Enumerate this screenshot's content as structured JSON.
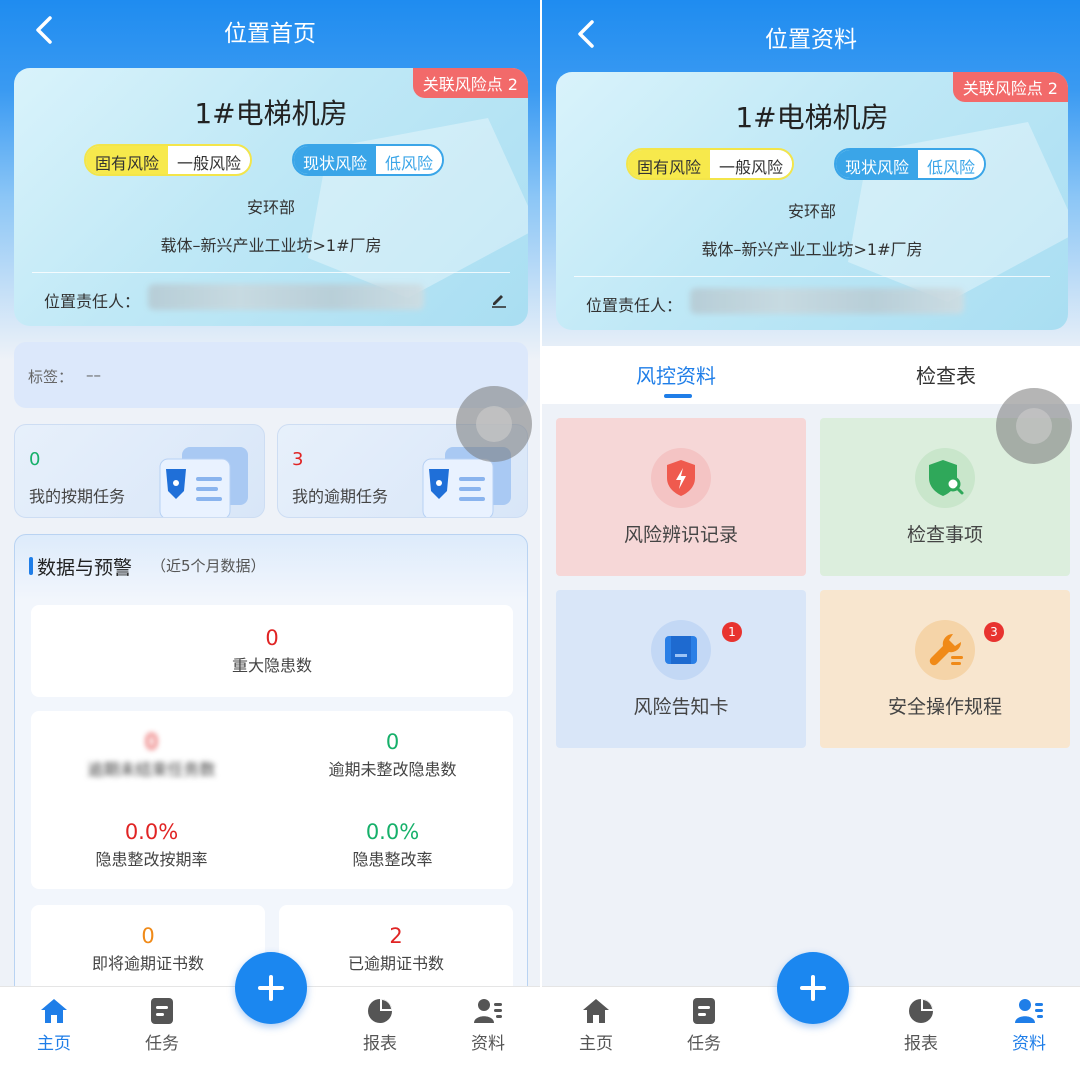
{
  "left": {
    "header": {
      "title": "位置首页"
    },
    "location": {
      "badge": "关联风险点 2",
      "name": "1#电梯机房",
      "inherent_risk_label": "固有风险",
      "inherent_risk_value": "一般风险",
      "current_risk_label": "现状风险",
      "current_risk_value": "低风险",
      "department": "安环部",
      "path": "载体–新兴产业工业坊>1#厂房",
      "owner_label": "位置责任人："
    },
    "tags": {
      "label": "标签：",
      "value": "––"
    },
    "tasks": [
      {
        "count": "0",
        "label": "我的按期任务"
      },
      {
        "count": "3",
        "label": "我的逾期任务"
      }
    ],
    "data_section": {
      "title": "数据与预警",
      "subtitle": "（近5个月数据）",
      "major_hazards": {
        "value": "0",
        "label": "重大隐患数"
      },
      "overdue_unfinished_tasks": {
        "value": "0",
        "label": "逾期未结束任务数"
      },
      "overdue_unrectified": {
        "value": "0",
        "label": "逾期未整改隐患数"
      },
      "ontime_rectify_rate": {
        "value": "0.0%",
        "label": "隐患整改按期率"
      },
      "rectify_rate": {
        "value": "0.0%",
        "label": "隐患整改率"
      },
      "expiring_certs": {
        "value": "0",
        "label": "即将逾期证书数"
      },
      "expired_certs": {
        "value": "2",
        "label": "已逾期证书数"
      }
    },
    "tabbar": [
      {
        "label": "主页",
        "icon": "home-icon"
      },
      {
        "label": "任务",
        "icon": "task-icon"
      },
      {
        "label": "报表",
        "icon": "pie-chart-icon"
      },
      {
        "label": "资料",
        "icon": "profile-icon"
      }
    ],
    "active_tab": "主页"
  },
  "right": {
    "header": {
      "title": "位置资料"
    },
    "location": {
      "badge": "关联风险点 2",
      "name": "1#电梯机房",
      "inherent_risk_label": "固有风险",
      "inherent_risk_value": "一般风险",
      "current_risk_label": "现状风险",
      "current_risk_value": "低风险",
      "department": "安环部",
      "path": "载体–新兴产业工业坊>1#厂房",
      "owner_label": "位置责任人："
    },
    "tabs": [
      {
        "label": "风控资料",
        "active": true
      },
      {
        "label": "检查表",
        "active": false
      }
    ],
    "tiles": [
      {
        "label": "风险辨识记录",
        "icon": "shield-lightning-icon",
        "badge": ""
      },
      {
        "label": "检查事项",
        "icon": "shield-search-icon",
        "badge": ""
      },
      {
        "label": "风险告知卡",
        "icon": "card-icon",
        "badge": "1"
      },
      {
        "label": "安全操作规程",
        "icon": "wrench-icon",
        "badge": "3"
      }
    ],
    "tabbar": [
      {
        "label": "主页",
        "icon": "home-icon"
      },
      {
        "label": "任务",
        "icon": "task-icon"
      },
      {
        "label": "报表",
        "icon": "pie-chart-icon"
      },
      {
        "label": "资料",
        "icon": "profile-icon"
      }
    ],
    "active_tab": "资料"
  },
  "colors": {
    "primary": "#1f7ee8",
    "header_blue": "#1f8cf0",
    "danger": "#e02424",
    "success": "#16b06a",
    "warning": "#f08a18",
    "badge_red": "#f26a6a"
  }
}
